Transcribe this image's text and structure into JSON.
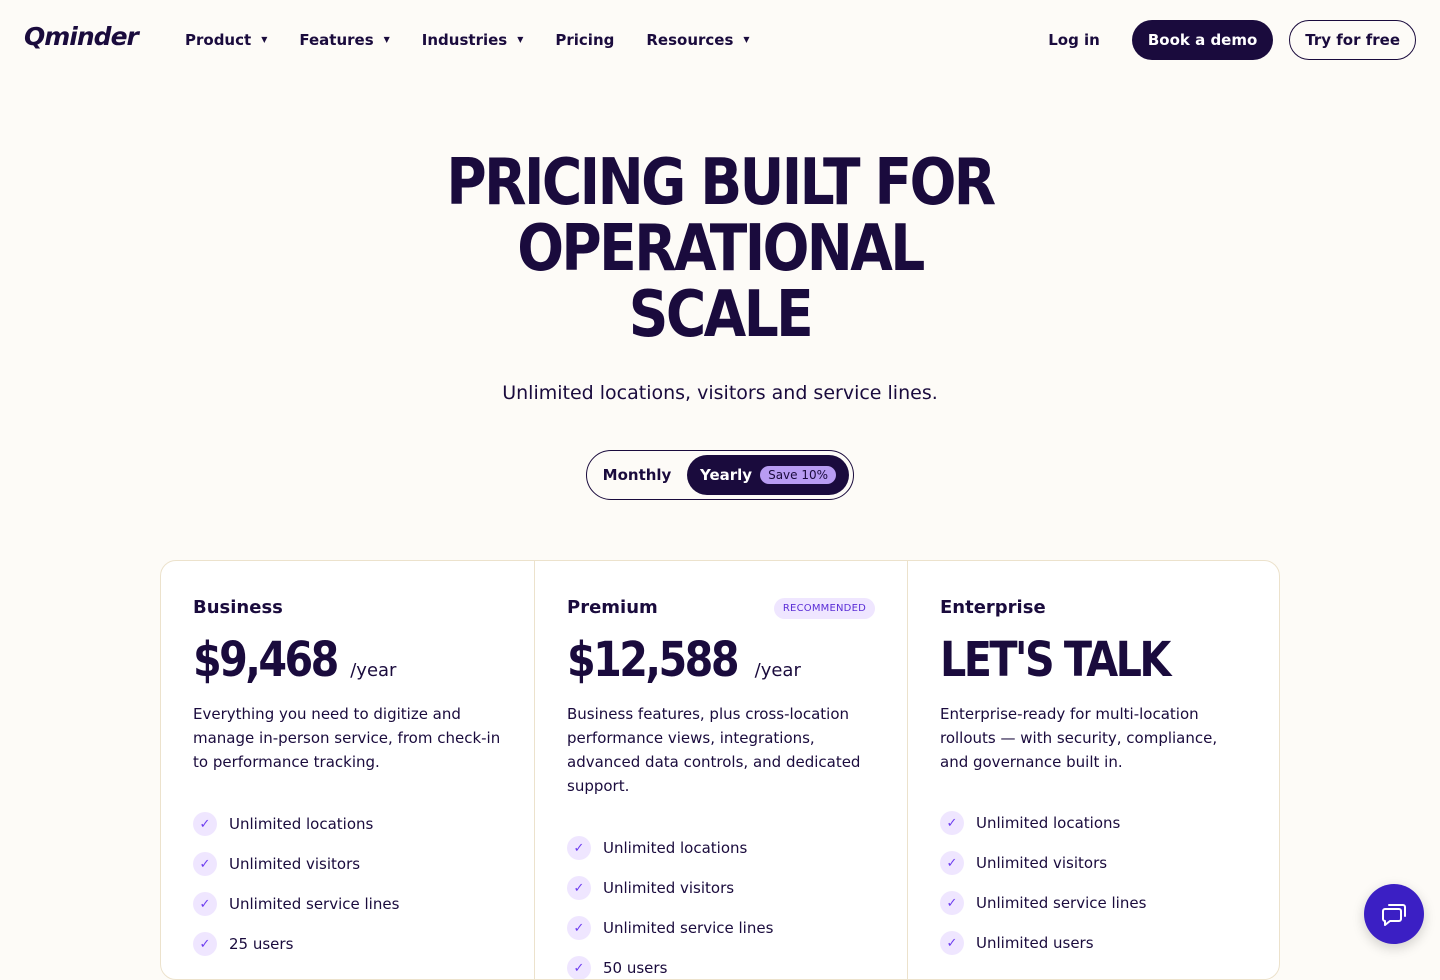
{
  "nav": {
    "logo": "Qminder",
    "menu": [
      {
        "label": "Product",
        "has_caret": true
      },
      {
        "label": "Features",
        "has_caret": true
      },
      {
        "label": "Industries",
        "has_caret": true
      },
      {
        "label": "Pricing",
        "has_caret": false
      },
      {
        "label": "Resources",
        "has_caret": true
      }
    ],
    "login": "Log in",
    "book_demo": "Book a demo",
    "try_free": "Try for free"
  },
  "hero": {
    "title_lines": [
      "PRICING BUILT FOR",
      "OPERATIONAL",
      "SCALE"
    ],
    "subtitle": "Unlimited locations, visitors and service lines."
  },
  "billing_toggle": {
    "monthly": "Monthly",
    "yearly": "Yearly",
    "save_badge": "Save 10%",
    "selected": "Yearly"
  },
  "plans": [
    {
      "name": "Business",
      "price": "$9,468",
      "period": "/year",
      "description": "Everything you need to digitize and manage in-person service, from check-in to performance tracking.",
      "features": [
        "Unlimited locations",
        "Unlimited visitors",
        "Unlimited service lines",
        "25 users"
      ]
    },
    {
      "name": "Premium",
      "badge": "RECOMMENDED",
      "price": "$12,588",
      "period": "/year",
      "description": "Business features, plus cross-location performance views, integrations, advanced data controls, and dedicated support.",
      "features": [
        "Unlimited locations",
        "Unlimited visitors",
        "Unlimited service lines",
        "50 users"
      ]
    },
    {
      "name": "Enterprise",
      "price": "LET'S TALK",
      "period": "",
      "description": "Enterprise-ready for multi-location rollouts — with security, compliance, and governance built in.",
      "features": [
        "Unlimited locations",
        "Unlimited visitors",
        "Unlimited service lines",
        "Unlimited users"
      ]
    }
  ],
  "chat": {
    "icon": "chat-icon"
  },
  "colors": {
    "primary": "#1a0b3d",
    "accent": "#3b1fc4",
    "badge_bg": "#efe6ff",
    "background": "#fdfbf7"
  }
}
